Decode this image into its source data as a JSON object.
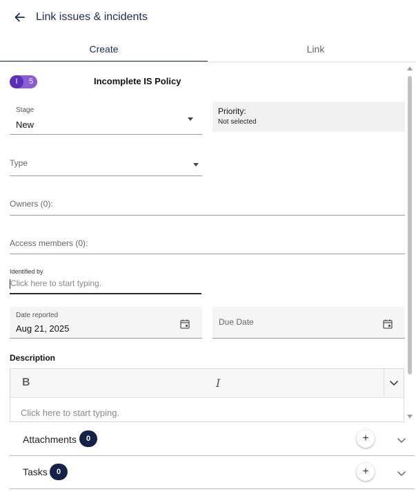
{
  "header": {
    "title": "Link issues & incidents",
    "back_icon": "arrow-left-icon"
  },
  "tabs": [
    {
      "label": "Create",
      "active": true
    },
    {
      "label": "Link",
      "active": false
    }
  ],
  "record": {
    "badge_letter": "I",
    "badge_number": "5",
    "name": "Incomplete IS Policy"
  },
  "stage": {
    "label": "Stage",
    "value": "New"
  },
  "priority": {
    "label": "Priority:",
    "value": "Not selected"
  },
  "type": {
    "placeholder": "Type"
  },
  "owners": {
    "label": "Owners (0):"
  },
  "access_members": {
    "label": "Access members (0):"
  },
  "identified_by": {
    "label": "Identified by",
    "placeholder": "Click here to start typing."
  },
  "date_reported": {
    "label": "Date reported",
    "value": "Aug 21, 2025"
  },
  "due_date": {
    "placeholder": "Due Date"
  },
  "description": {
    "label": "Description",
    "bold_label": "B",
    "italic_label": "I",
    "placeholder": "Click here to start typing."
  },
  "accordions": [
    {
      "label": "Attachments",
      "count": "0",
      "add_label": "+"
    },
    {
      "label": "Tasks",
      "count": "0",
      "add_label": "+"
    }
  ],
  "colors": {
    "primary": "#1b2a4e",
    "badge_dark": "#5b2fb6",
    "badge_light": "#8a5cd6",
    "count_bg": "#14224a"
  }
}
